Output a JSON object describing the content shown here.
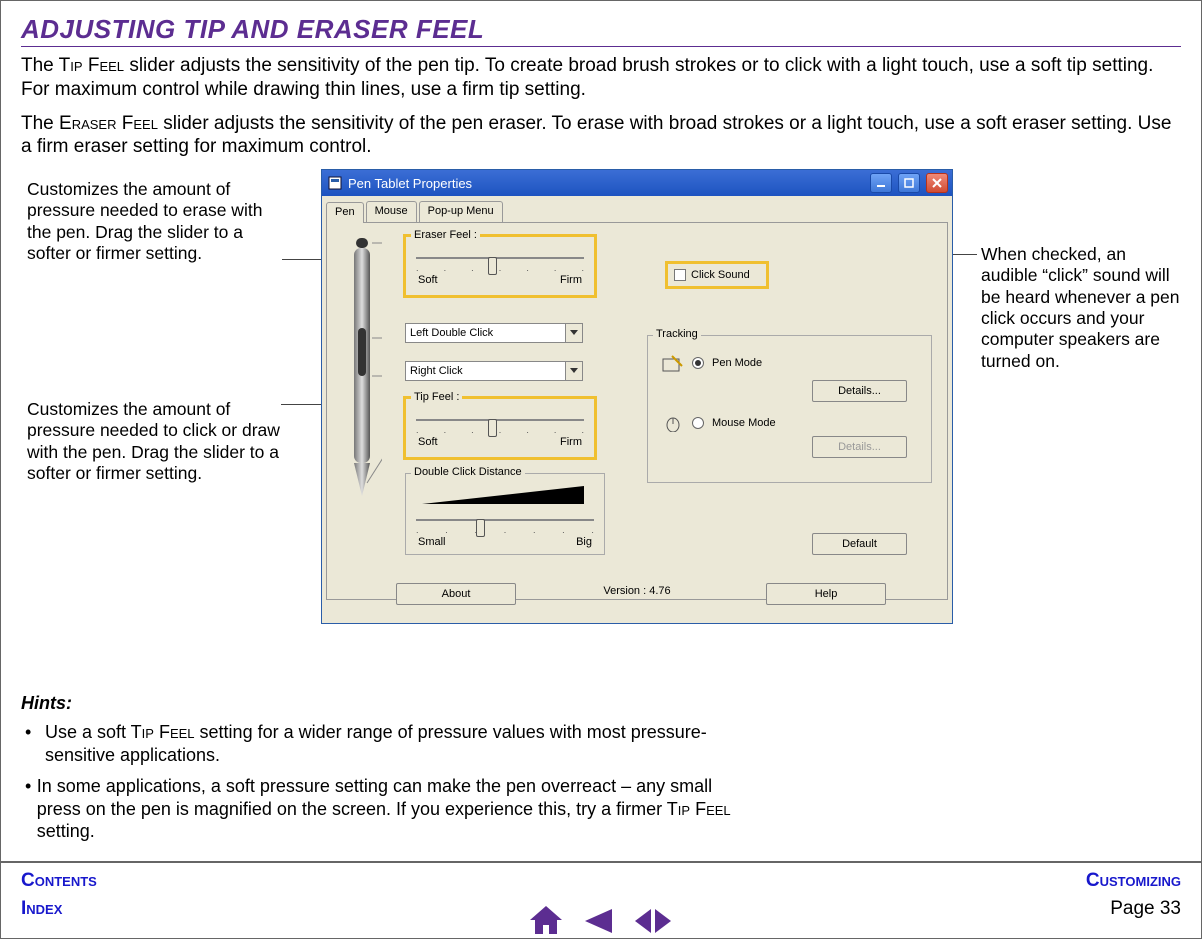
{
  "heading": "ADJUSTING TIP AND ERASER FEEL",
  "paragraphs": {
    "p1a": "The  T",
    "p1b": "ip",
    "p1c": " F",
    "p1d": "eel",
    "p1e": " slider adjusts the sensitivity of the pen tip.  To create broad brush strokes or to click with a light touch, use a soft tip setting.  For maximum control while drawing thin lines, use a firm tip setting.",
    "p2a": "The E",
    "p2b": "raser",
    "p2c": " F",
    "p2d": "eel",
    "p2e": " slider adjusts the sensitivity of the pen eraser.  To erase with broad strokes or a light touch, use a soft eraser setting.  Use a firm eraser setting for maximum control."
  },
  "annotations": {
    "left1": "Customizes the amount of pressure needed to erase with the pen.  Drag the slider to a softer or firmer setting.",
    "left2": "Customizes the amount of pressure needed to click or draw with the pen.  Drag the slider to a softer or firmer setting.",
    "right": "When checked, an audible “click” sound will be heard whenever a pen click occurs and your computer speakers are turned on."
  },
  "window": {
    "title": "Pen Tablet Properties",
    "tabs": [
      "Pen",
      "Mouse",
      "Pop-up Menu"
    ],
    "eraser_feel": {
      "label": "Eraser Feel :",
      "soft": "Soft",
      "firm": "Firm"
    },
    "tip_feel": {
      "label": "Tip Feel :",
      "soft": "Soft",
      "firm": "Firm"
    },
    "left_dc": "Left Double Click",
    "right_click": "Right Click",
    "click_sound": "Click Sound",
    "tracking": {
      "label": "Tracking",
      "pen_mode": "Pen Mode",
      "mouse_mode": "Mouse Mode",
      "details": "Details..."
    },
    "dcd": {
      "label": "Double Click Distance",
      "small": "Small",
      "big": "Big"
    },
    "default": "Default",
    "version": "Version : 4.76",
    "about": "About",
    "help": "Help"
  },
  "hints": {
    "title": "Hints:",
    "items": [
      {
        "a": "Use a soft T",
        "b": "ip",
        "c": " F",
        "d": "eel",
        "e": " setting for a wider range of pressure values with most pressure-sensitive applications."
      },
      {
        "a": "In some applications, a soft pressure setting can make the pen overreact – any small press on the pen is magnified on the screen.  If you experience this, try a firmer T",
        "b": "ip",
        "c": " F",
        "d": "eel",
        "e": " setting."
      }
    ]
  },
  "footer": {
    "contents": "Contents",
    "index": "Index",
    "customizing": "Customizing",
    "page_label": "Page  33"
  }
}
